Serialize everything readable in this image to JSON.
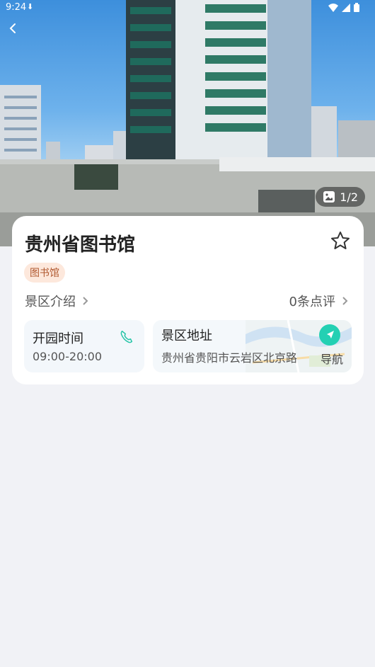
{
  "status_bar": {
    "time": "9:24"
  },
  "gallery": {
    "counter": "1/2"
  },
  "venue": {
    "name": "贵州省图书馆",
    "tag": "图书馆",
    "intro_label": "景区介绍",
    "reviews_label": "0条点评"
  },
  "hours": {
    "label": "开园时间",
    "value": "09:00-20:00"
  },
  "address": {
    "label": "景区地址",
    "value": "贵州省贵阳市云岩区北京路",
    "nav_label": "导航"
  },
  "colors": {
    "accent": "#23d0b3",
    "tag_bg": "#fde8dc",
    "tag_text": "#b0572e"
  }
}
